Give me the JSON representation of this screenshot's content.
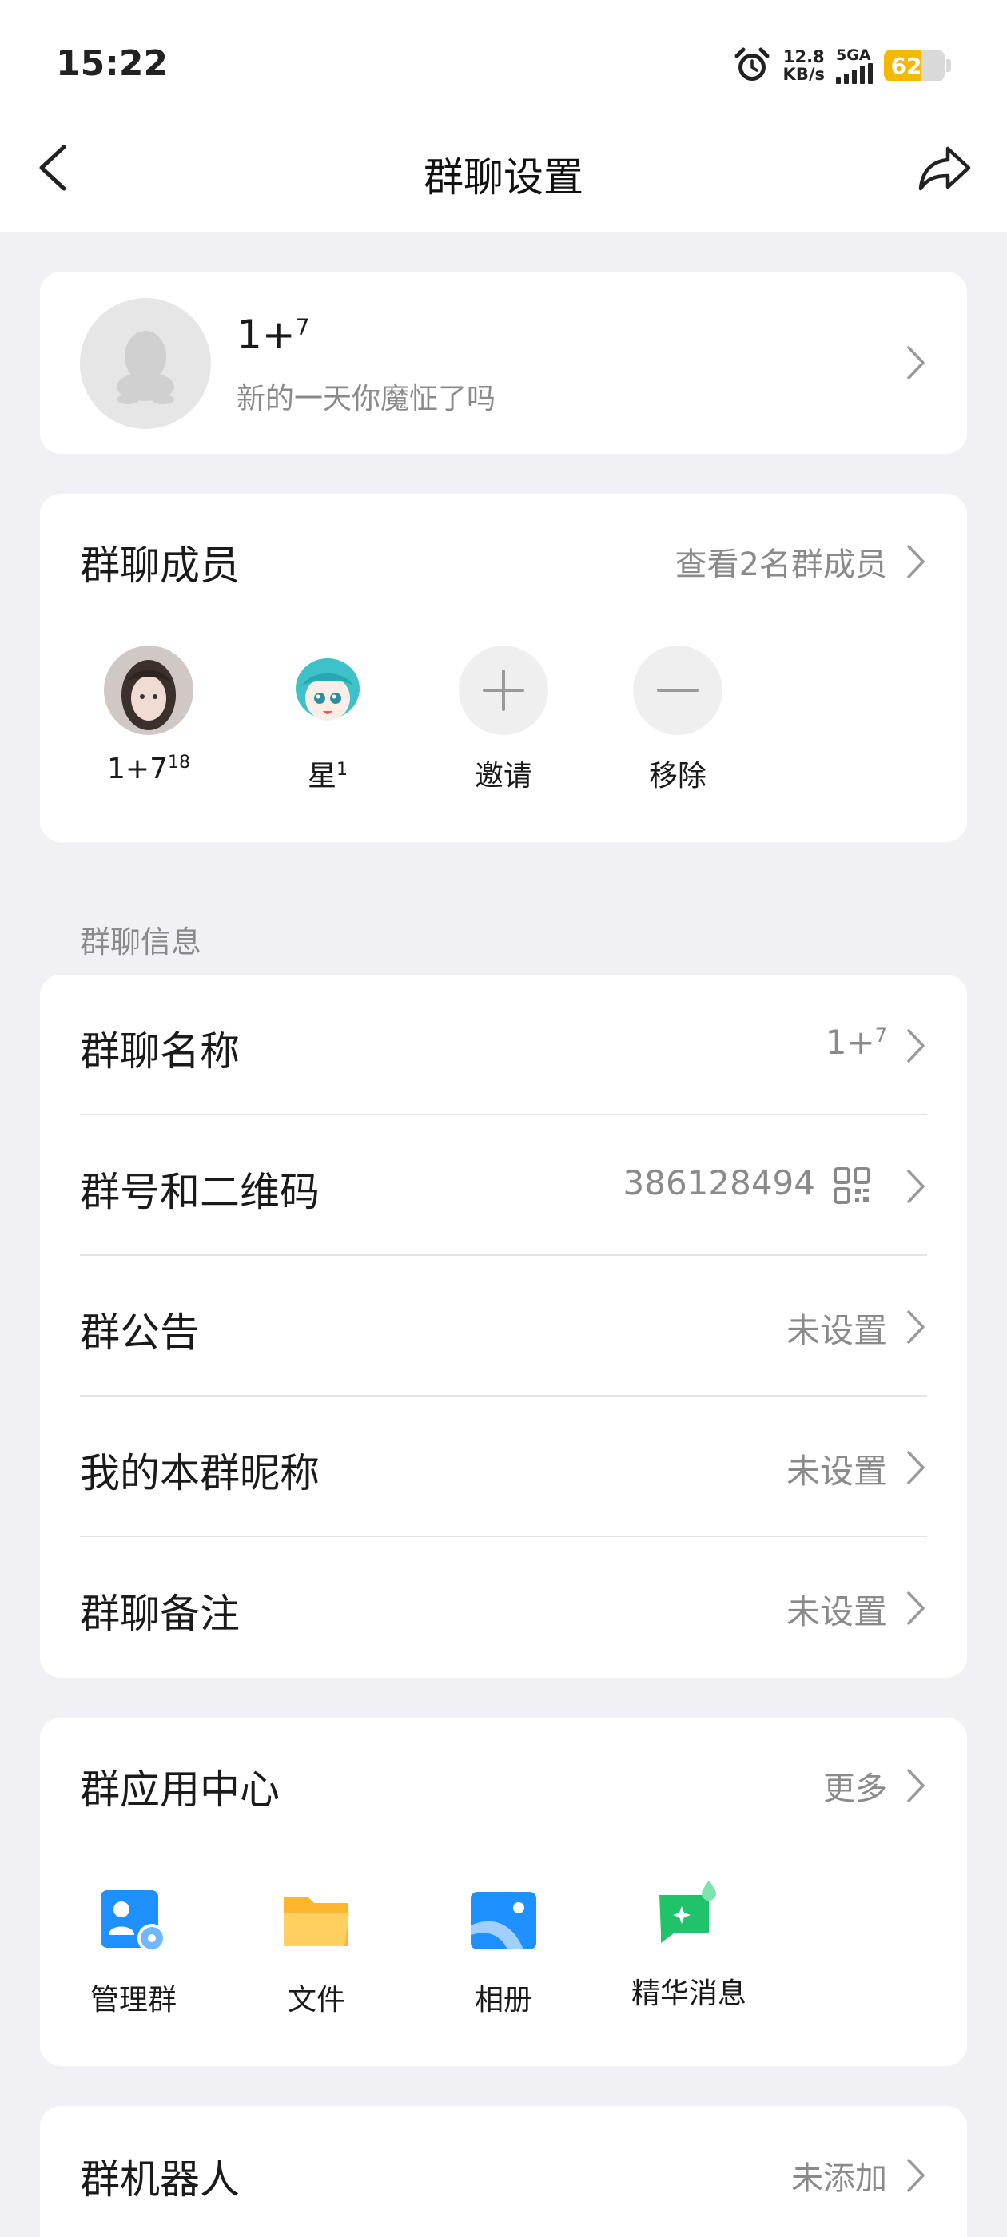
{
  "status_bar": {
    "time": "15:22",
    "net_speed_value": "12.8",
    "net_speed_unit": "KB/s",
    "network": "5GA",
    "battery": "62"
  },
  "nav": {
    "title": "群聊设置"
  },
  "group": {
    "name": "1+",
    "name_sup": "7",
    "description": "新的一天你魔怔了吗"
  },
  "members": {
    "title": "群聊成员",
    "view_all": "查看2名群成员",
    "list": [
      {
        "name": "1+7",
        "sup": "18"
      },
      {
        "name": "星",
        "sup": "1"
      }
    ],
    "invite_label": "邀请",
    "remove_label": "移除"
  },
  "info_section_label": "群聊信息",
  "info": {
    "name_label": "群聊名称",
    "name_value": "1+",
    "name_value_sup": "7",
    "number_label": "群号和二维码",
    "number_value": "386128494",
    "notice_label": "群公告",
    "notice_value": "未设置",
    "nickname_label": "我的本群昵称",
    "nickname_value": "未设置",
    "remark_label": "群聊备注",
    "remark_value": "未设置"
  },
  "apps": {
    "title": "群应用中心",
    "more": "更多",
    "items": [
      {
        "label": "管理群",
        "icon": "manage-group-icon"
      },
      {
        "label": "文件",
        "icon": "folder-icon"
      },
      {
        "label": "相册",
        "icon": "album-icon"
      },
      {
        "label": "精华消息",
        "icon": "essence-message-icon"
      }
    ]
  },
  "robot": {
    "label": "群机器人",
    "value": "未添加"
  },
  "colors": {
    "background": "#f1f1f5",
    "card": "#ffffff",
    "secondary_text": "#8a8a8a",
    "blue": "#1e90ff",
    "yellow": "#ffc43d",
    "green": "#20c26a",
    "battery": "#f5b800"
  }
}
